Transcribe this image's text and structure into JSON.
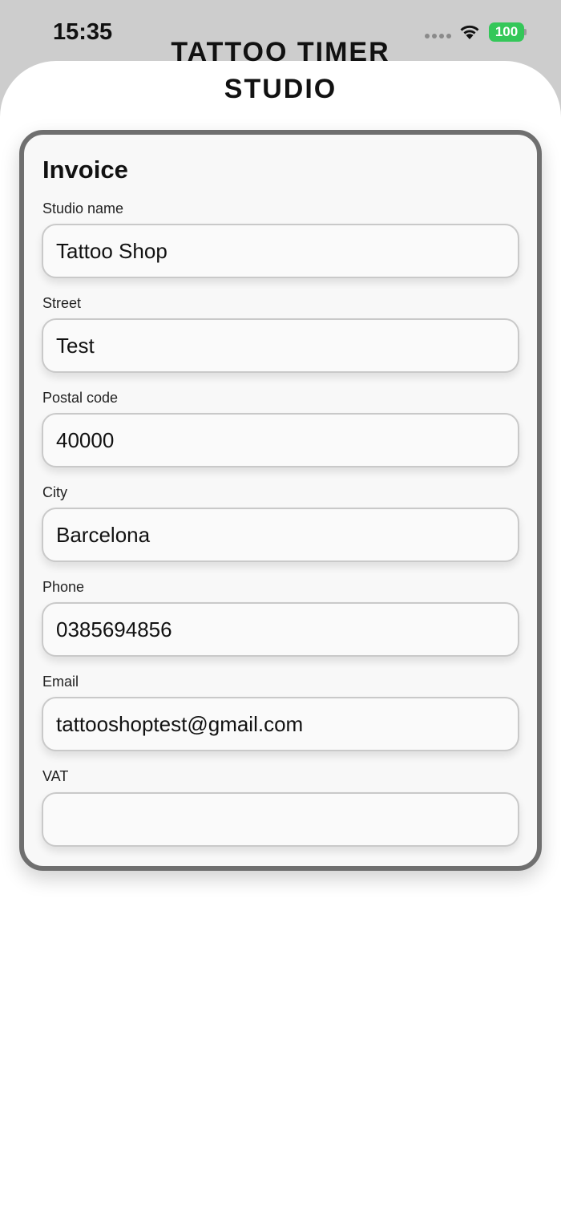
{
  "status_bar": {
    "time": "15:35",
    "battery": "100",
    "icons": [
      "signal-dots-icon",
      "wifi-icon",
      "battery-icon"
    ],
    "battery_color": "#34c759"
  },
  "header": {
    "title_line1": "TATTOO TIMER",
    "title_line2": "STUDIO"
  },
  "invoice": {
    "title": "Invoice",
    "fields": [
      {
        "label": "Studio name",
        "value": "Tattoo Shop"
      },
      {
        "label": "Street",
        "value": "Test"
      },
      {
        "label": "Postal code",
        "value": "40000"
      },
      {
        "label": "City",
        "value": "Barcelona"
      },
      {
        "label": "Phone",
        "value": "0385694856"
      },
      {
        "label": "Email",
        "value": "tattooshoptest@gmail.com"
      },
      {
        "label": "VAT",
        "value": ""
      }
    ]
  }
}
